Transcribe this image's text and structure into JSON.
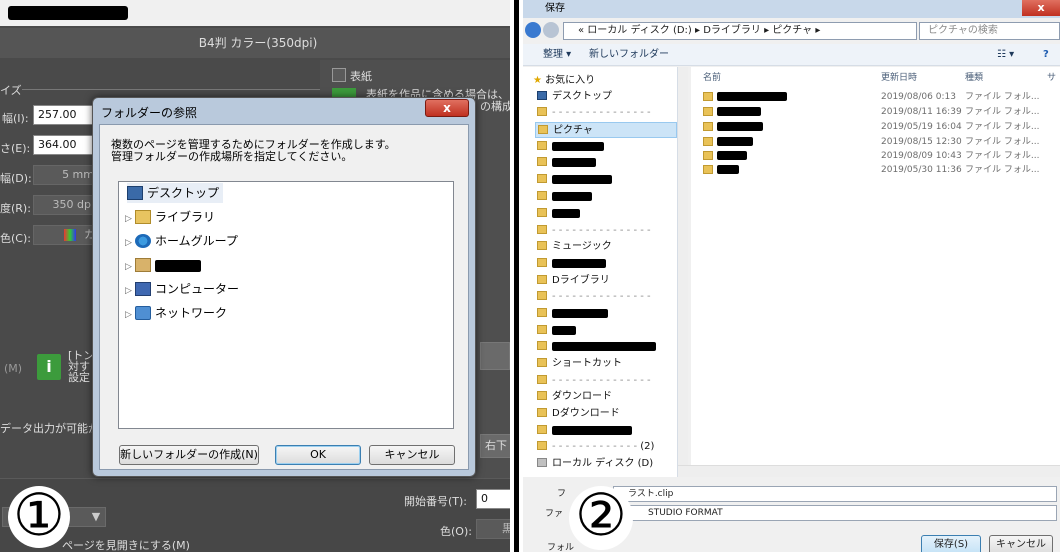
{
  "left": {
    "document_size": "B4判 カラー(350dpi)",
    "section_size_label": "イズ",
    "width_label": "幅(I):",
    "width_value": "257.00",
    "height_label": "さ(E):",
    "height_value": "364.00",
    "bleed_label": "幅(D):",
    "bleed_value": "5 mm",
    "res_label": "度(R):",
    "res_value": "350 dpi",
    "color_label": "色(C):",
    "color_value": "カ",
    "cover_label": "表紙",
    "cover_note": "表紙を作品に含める場合は、",
    "cover_note2": "の構成",
    "m_label": "(M)",
    "info_text": [
      "[トン",
      "対す",
      "設定"
    ],
    "data_output_label": "データ出力が可能か",
    "right_bottom": "右下",
    "start_number_label": "開始番号(T):",
    "start_number_value": "0",
    "color_o_label": "色(O):",
    "color_o_value": "黒",
    "spread_label": "ページを見開きにする(M)",
    "circle_number": "①",
    "dialog": {
      "title": "フォルダーの参照",
      "close": "x",
      "message_line1": "複数のページを管理するためにフォルダーを作成します。",
      "message_line2": "管理フォルダーの作成場所を指定してください。",
      "tree": [
        {
          "label": "デスクトップ",
          "icon": "desktop-icon"
        },
        {
          "label": "ライブラリ",
          "icon": "library-icon"
        },
        {
          "label": "ホームグループ",
          "icon": "homegroup-icon"
        },
        {
          "label": "",
          "icon": "user-folder-icon"
        },
        {
          "label": "コンピューター",
          "icon": "computer-icon"
        },
        {
          "label": "ネットワーク",
          "icon": "network-icon"
        }
      ],
      "new_folder_button": "新しいフォルダーの作成(N)",
      "ok_button": "OK",
      "cancel_button": "キャンセル"
    }
  },
  "right": {
    "window_title": "保存",
    "address": "« ローカル ディスク (D:) ▸ Dライブラリ ▸ ピクチャ ▸",
    "search_placeholder": "ピクチャの検索",
    "organize": "整理 ▾",
    "new_folder": "新しいフォルダー",
    "nav": {
      "favorites": "お気に入り",
      "desktop": "デスクトップ",
      "pictures": "ピクチャ",
      "music": "ミュージック",
      "dlibrary": "Dライブラリ",
      "shortcut": "ショートカット",
      "download": "ダウンロード",
      "ddownload": "Dダウンロード",
      "sep_count": "(2)",
      "local_disk": "ローカル ディスク (D)"
    },
    "columns": [
      "名前",
      "更新日時",
      "種類",
      "サ"
    ],
    "rows": [
      {
        "date": "2019/08/06 0:13",
        "type": "ファイル フォル..."
      },
      {
        "date": "2019/08/11 16:39",
        "type": "ファイル フォル..."
      },
      {
        "date": "2019/05/19 16:04",
        "type": "ファイル フォル..."
      },
      {
        "date": "2019/08/15 12:30",
        "type": "ファイル フォル..."
      },
      {
        "date": "2019/08/09 10:43",
        "type": "ファイル フォル..."
      },
      {
        "date": "2019/05/30 11:36",
        "type": "ファイル フォル..."
      }
    ],
    "filename_label": "フ",
    "filename_value": "ラスト.clip",
    "filetype_label": "ファ",
    "filetype_value": "STUDIO FORMAT",
    "folder_label": "フォル",
    "save_button": "保存(S)",
    "cancel_button": "キャンセル",
    "circle_number": "②"
  }
}
